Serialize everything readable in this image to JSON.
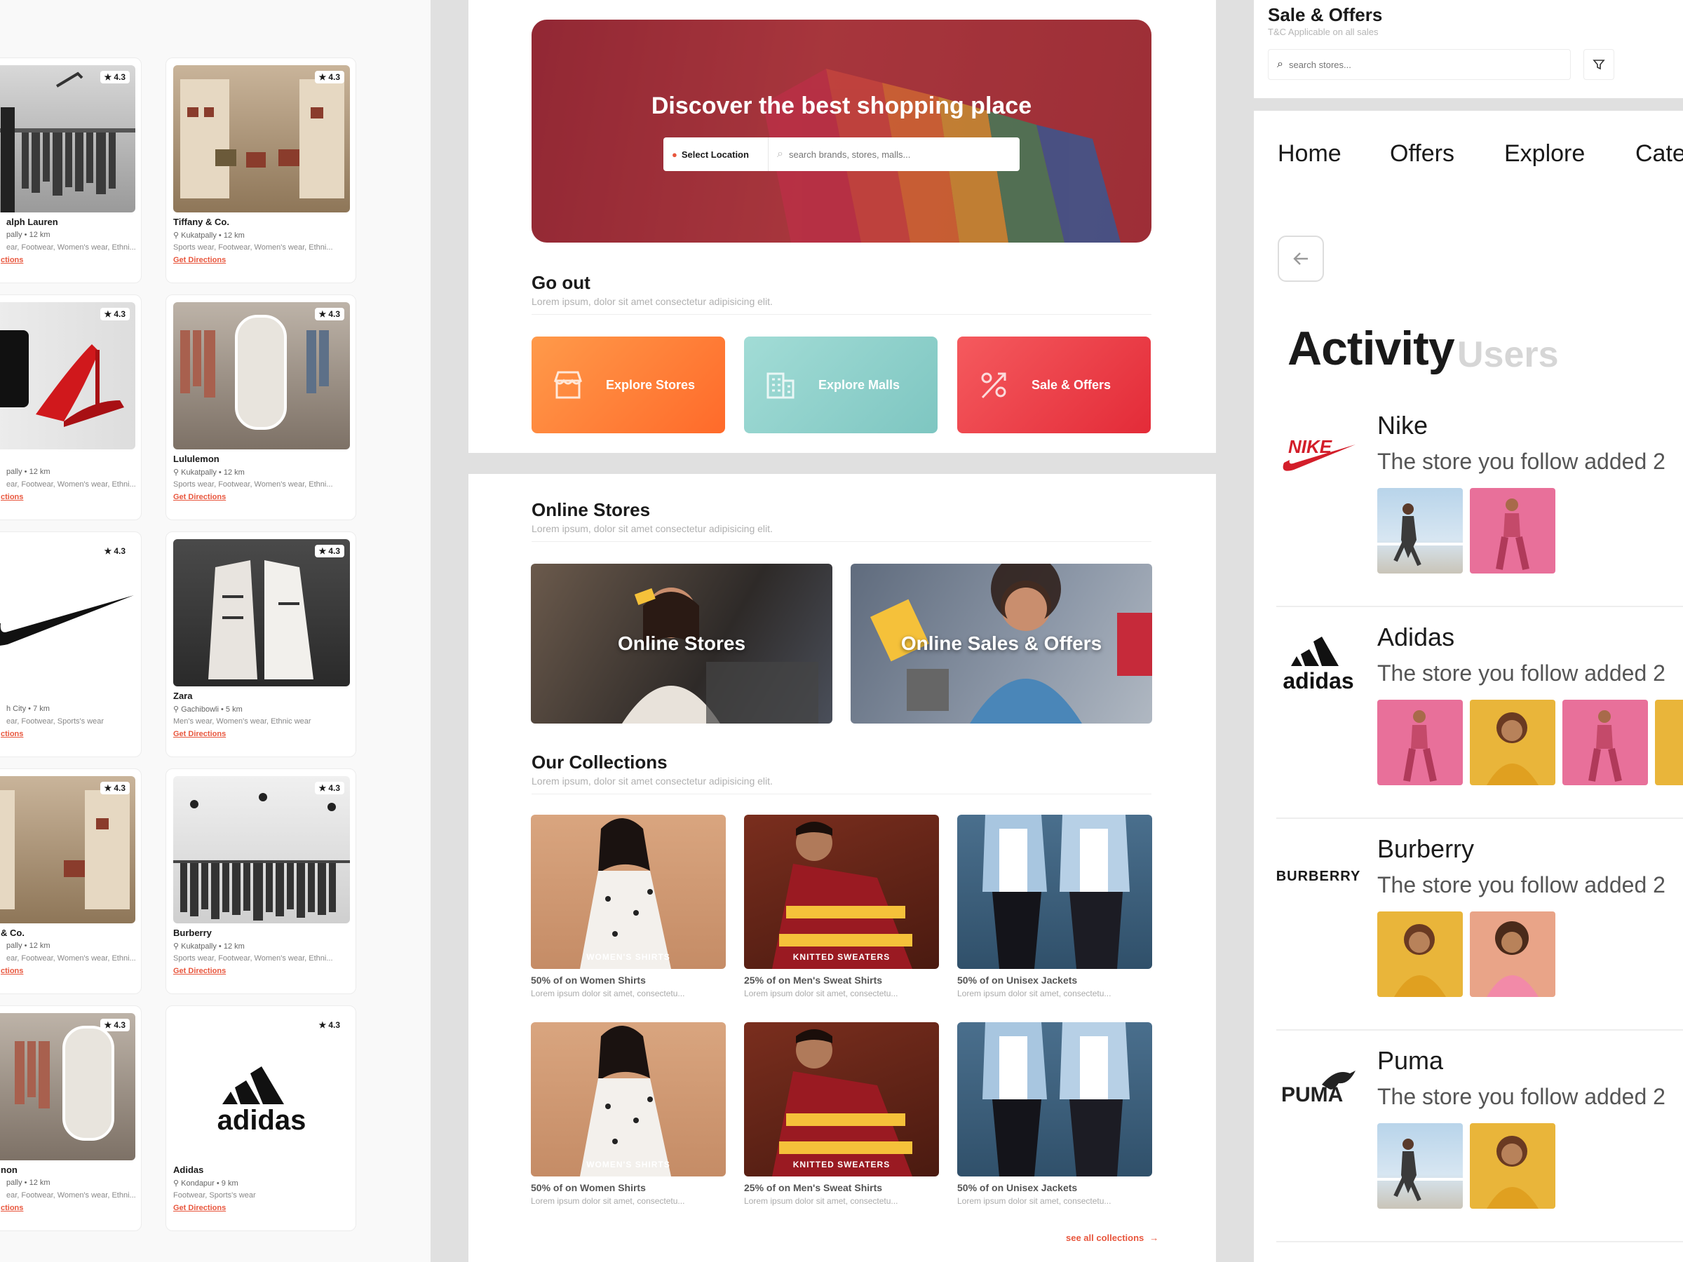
{
  "left_cards": [
    {
      "name": "alph Lauren",
      "rating": "4.3",
      "location": "pally • 12 km",
      "categories": "ear, Footwear, Women's wear, Ethni...",
      "directions": "ctions"
    },
    {
      "name": "Tiffany & Co.",
      "rating": "4.3",
      "location": "Kukatpally • 12 km",
      "categories": "Sports wear, Footwear, Women's wear, Ethni...",
      "directions": "Get Directions"
    },
    {
      "name": "",
      "rating": "4.3",
      "location": "pally • 12 km",
      "categories": "ear, Footwear, Women's wear, Ethni...",
      "directions": "ctions"
    },
    {
      "name": "Lululemon",
      "rating": "4.3",
      "location": "Kukatpally • 12 km",
      "categories": "Sports wear, Footwear, Women's wear, Ethni...",
      "directions": "Get Directions"
    },
    {
      "name": "",
      "rating": "4.3",
      "location": "h City • 7 km",
      "categories": "ear, Footwear, Sports's wear",
      "directions": "ctions"
    },
    {
      "name": "Zara",
      "rating": "4.3",
      "location": "Gachibowli • 5 km",
      "categories": "Men's wear, Women's wear, Ethnic wear",
      "directions": "Get Directions"
    },
    {
      "name": "& Co.",
      "rating": "4.3",
      "location": "pally • 12 km",
      "categories": "ear, Footwear, Women's wear, Ethni...",
      "directions": "ctions"
    },
    {
      "name": "Burberry",
      "rating": "4.3",
      "location": "Kukatpally • 12 km",
      "categories": "Sports wear, Footwear, Women's wear, Ethni...",
      "directions": "Get Directions"
    },
    {
      "name": "non",
      "rating": "4.3",
      "location": "pally • 12 km",
      "categories": "ear, Footwear, Women's wear, Ethni...",
      "directions": "ctions"
    },
    {
      "name": "Adidas",
      "rating": "4.3",
      "location": "Kondapur • 9 km",
      "categories": "Footwear, Sports's wear",
      "directions": "Get Directions"
    }
  ],
  "hero": {
    "title": "Discover the best shopping place",
    "location_label": "Select Location",
    "search_placeholder": "search brands, stores, malls..."
  },
  "go_out": {
    "title": "Go out",
    "subtitle": "Lorem ipsum, dolor sit amet consectetur adipisicing elit.",
    "tiles": [
      {
        "label": "Explore Stores",
        "color": "#ff7a3a"
      },
      {
        "label": "Explore Malls",
        "color": "#8fcfcc"
      },
      {
        "label": "Sale & Offers",
        "color": "#ee3b45"
      }
    ]
  },
  "online_stores": {
    "title": "Online Stores",
    "subtitle": "Lorem ipsum, dolor sit amet consectetur adipisicing elit.",
    "cards": [
      {
        "label": "Online Stores"
      },
      {
        "label": "Online Sales & Offers"
      }
    ]
  },
  "collections": {
    "title": "Our Collections",
    "subtitle": "Lorem ipsum, dolor sit amet consectetur adipisicing elit.",
    "items": [
      {
        "tag": "WOMEN'S SHIRTS",
        "title": "50% of on Women Shirts",
        "sub": "Lorem ipsum dolor sit amet, consectetu..."
      },
      {
        "tag": "KNITTED SWEATERS",
        "title": "25% of on Men's Sweat Shirts",
        "sub": "Lorem ipsum dolor sit amet, consectetu..."
      },
      {
        "tag": "",
        "title": "50% of on Unisex Jackets",
        "sub": "Lorem ipsum dolor sit amet, consectetu..."
      },
      {
        "tag": "WOMEN'S SHIRTS",
        "title": "50% of on Women Shirts",
        "sub": "Lorem ipsum dolor sit amet, consectetu..."
      },
      {
        "tag": "KNITTED SWEATERS",
        "title": "25% of on Men's Sweat Shirts",
        "sub": "Lorem ipsum dolor sit amet, consectetu..."
      },
      {
        "tag": "",
        "title": "50% of on Unisex Jackets",
        "sub": "Lorem ipsum dolor sit amet, consectetu..."
      }
    ],
    "see_all": "see all collections"
  },
  "sale_header": {
    "title": "Sale & Offers",
    "subtitle": "T&C Applicable on all sales",
    "search_placeholder": "search stores..."
  },
  "nav": {
    "items": [
      "Home",
      "Offers",
      "Explore",
      "Cate"
    ]
  },
  "activity": {
    "title": "Activity",
    "tab_users": "Users",
    "brands": [
      {
        "name": "Nike",
        "desc": "The store you follow added 2"
      },
      {
        "name": "Adidas",
        "desc": "The store you follow added 2"
      },
      {
        "name": "Burberry",
        "desc": "The store you follow added 2",
        "logo_text": "BURBERRY"
      },
      {
        "name": "Puma",
        "desc": "The store you follow added 2"
      }
    ]
  },
  "accent": "#e8563d"
}
